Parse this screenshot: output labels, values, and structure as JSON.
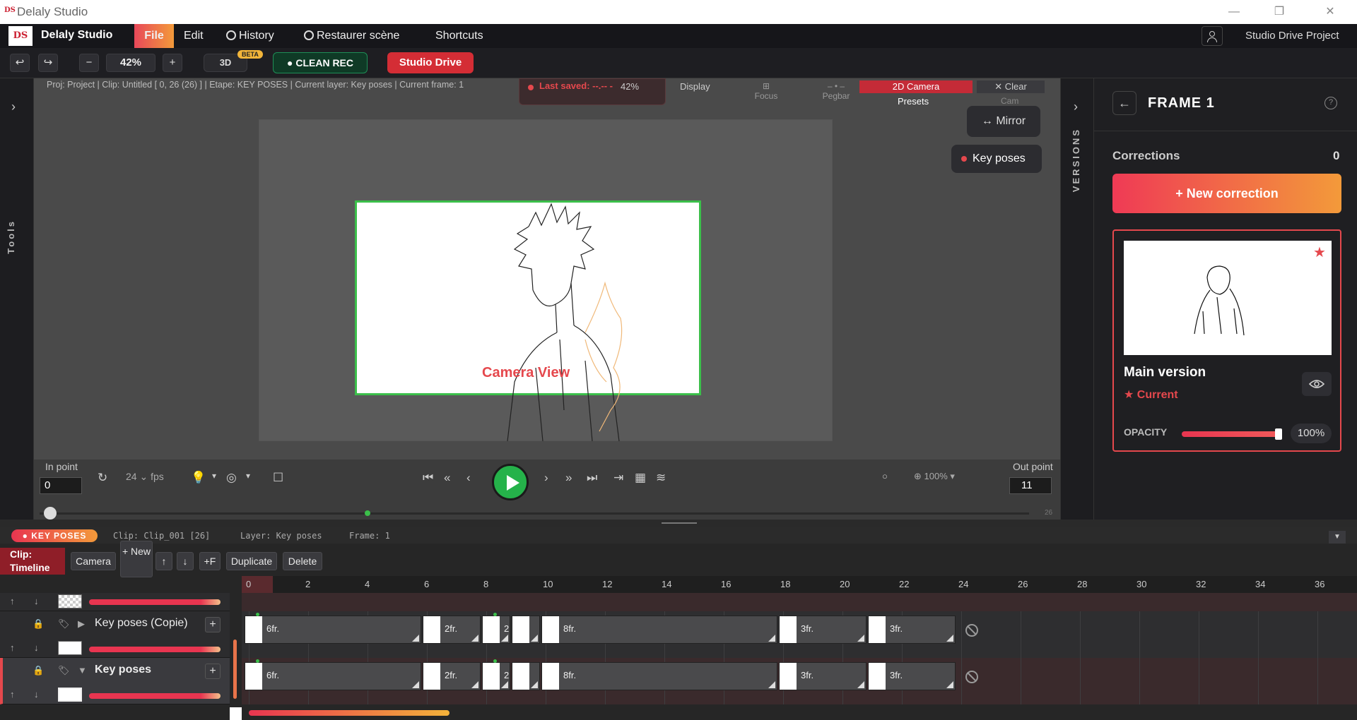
{
  "window": {
    "title": "Delaly Studio",
    "logo": "DS"
  },
  "menubar": {
    "logo": "DS",
    "brand": "Delaly Studio",
    "items": [
      {
        "label": "File"
      },
      {
        "label": "Edit"
      },
      {
        "label": "History"
      },
      {
        "label": "Restaurer scène"
      },
      {
        "label": "Shortcuts"
      }
    ],
    "project": "Studio Drive Project"
  },
  "toolbar": {
    "zoom": "42%",
    "minus": "−",
    "plus": "+",
    "btn_3d": "3D",
    "beta": "BETA",
    "clean_rec": "● CLEAN REC",
    "studio_drive": "Studio Drive"
  },
  "left_rail": {
    "label": "Tools"
  },
  "viewport": {
    "info": "Proj: Project | Clip: Untitled [ 0, 26 (26) ] | Etape: KEY POSES | Current layer: Key poses | Current frame: 1",
    "last_saved": "Last saved: --.-- -",
    "zoom": "42%",
    "display": "Display",
    "focus": "Focus",
    "pegbar": "Pegbar",
    "camera_2d": "2D Camera",
    "clear": "✕ Clear",
    "presets": "Presets",
    "cam": "Cam",
    "mirror": "↔ Mirror",
    "key_poses": "Key poses",
    "camera_view": "Camera View",
    "in_point_label": "In point",
    "in_point": "0",
    "out_point_label": "Out point",
    "out_point": "11",
    "fps_value": "24",
    "fps_unit": "fps",
    "opacity": "100%",
    "scrub_end": "26"
  },
  "versions_rail": {
    "label": "VERSIONS"
  },
  "right_panel": {
    "title": "FRAME 1",
    "corrections_label": "Corrections",
    "corrections_count": "0",
    "new_correction": "+ New correction",
    "version_name": "Main version",
    "version_status": "★ Current",
    "opacity_label": "OPACITY",
    "opacity_value": "100%",
    "opacity_fraction": 1.0
  },
  "timeline": {
    "badge": "● KEY POSES",
    "clip_info": "Clip: Clip_001 [26]",
    "layer_info": "Layer: Key poses",
    "frame_info": "Frame: 1",
    "clip_label": "Clip: Timeline",
    "buttons": {
      "camera": "Camera",
      "new": "+ New",
      "up": "↑",
      "down": "↓",
      "plus_f": "+F",
      "duplicate": "Duplicate",
      "delete": "Delete"
    },
    "ruler": [
      "0",
      "2",
      "4",
      "6",
      "8",
      "10",
      "12",
      "14",
      "16",
      "18",
      "20",
      "22",
      "24",
      "26",
      "28",
      "30",
      "32",
      "34",
      "36"
    ],
    "layers": [
      {
        "name": "Key poses (Copie)"
      },
      {
        "name": "Key poses"
      }
    ],
    "cells": [
      "6fr.",
      "2fr.",
      "2",
      "",
      "8fr.",
      "3fr.",
      "3fr."
    ]
  }
}
